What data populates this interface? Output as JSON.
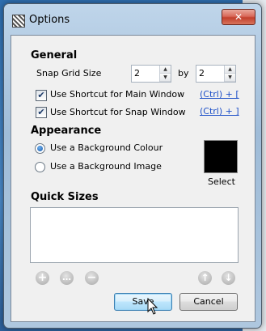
{
  "window": {
    "title": "Options",
    "close_glyph": "✕"
  },
  "general": {
    "heading": "General",
    "snap_grid_label": "Snap Grid Size",
    "snap_grid_x": "2",
    "by_label": "by",
    "snap_grid_y": "2",
    "shortcut_main": {
      "label": "Use Shortcut for Main Window",
      "checked": true,
      "link": "(Ctrl) + ["
    },
    "shortcut_snap": {
      "label": "Use Shortcut for Snap Window",
      "checked": true,
      "link": "(Ctrl) + ]"
    }
  },
  "appearance": {
    "heading": "Appearance",
    "option_colour": "Use a Background Colour",
    "option_image": "Use a Background Image",
    "selected": "colour",
    "swatch_color": "#000000",
    "select_label": "Select"
  },
  "quick_sizes": {
    "heading": "Quick Sizes",
    "items": []
  },
  "toolbar": {
    "add_icon": "+",
    "more_icon": "…",
    "remove_icon": "−",
    "up_icon": "↑",
    "down_icon": "↓"
  },
  "footer": {
    "save_label": "Save",
    "cancel_label": "Cancel"
  },
  "check_glyph": "✔"
}
